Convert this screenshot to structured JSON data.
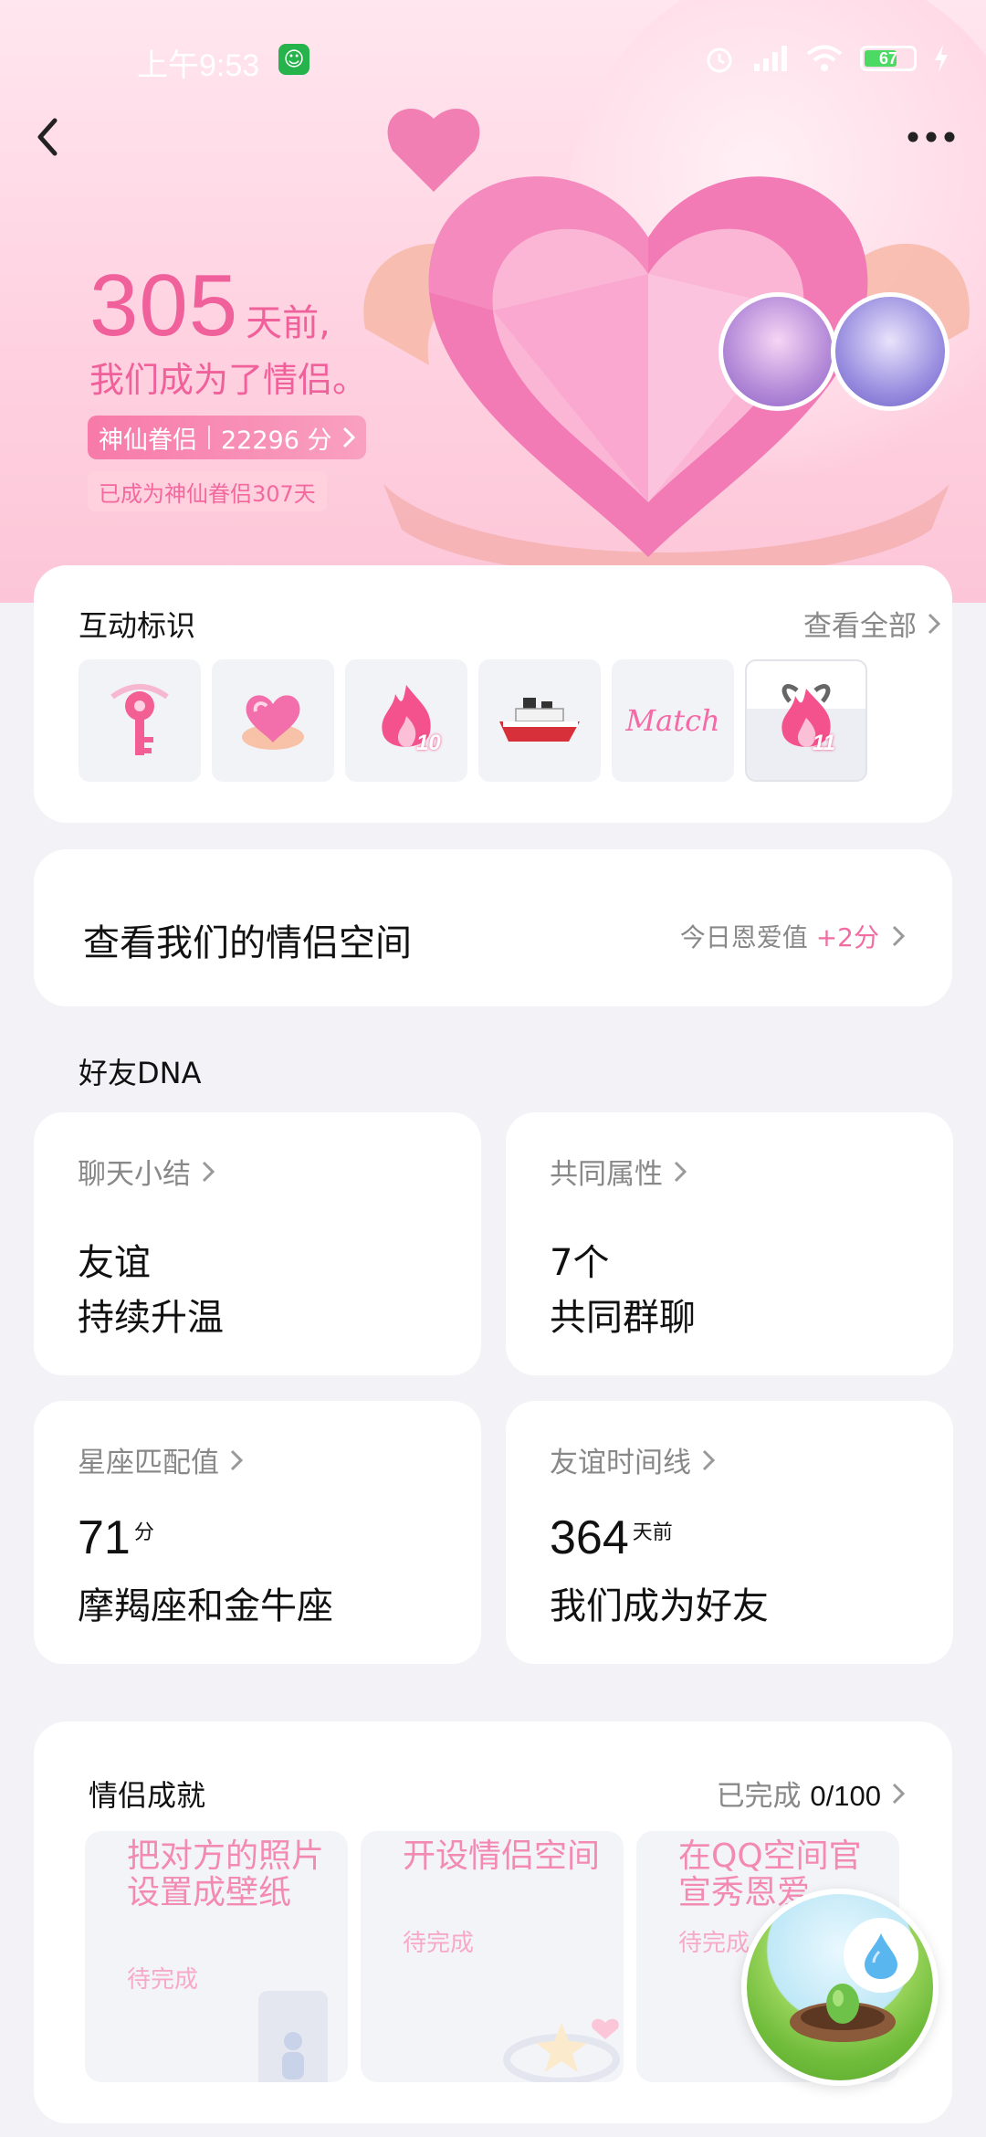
{
  "status_bar": {
    "time": "上午9:53",
    "battery": "67",
    "app_badge_icon": "cat-face-icon"
  },
  "hero": {
    "days_count": "305",
    "days_unit": "天前,",
    "subtitle": "我们成为了情侣。",
    "level_name": "神仙眷侣",
    "level_score": "22296 分",
    "since_text": "已成为神仙眷侣307天",
    "colors": {
      "accent": "#f0609a",
      "pill": "#f77aa8"
    }
  },
  "interaction_badges": {
    "title": "互动标识",
    "view_all": "查看全部",
    "badge_10": "10",
    "badge_11": "11",
    "match_text": "Match",
    "items": [
      "key-badge-icon",
      "heart-badge-icon",
      "fire-badge-icon",
      "ship-badge-icon",
      "match-badge-icon",
      "fire-badge-icon"
    ]
  },
  "couple_space": {
    "title": "查看我们的情侣空间",
    "meta_label": "今日恩爱值",
    "meta_value": "+2分"
  },
  "friend_dna": {
    "label": "好友DNA",
    "chat_summary": {
      "head": "聊天小结",
      "line1": "友谊",
      "line2": "持续升温"
    },
    "common": {
      "head": "共同属性",
      "line1": "7个",
      "line2": "共同群聊"
    },
    "zodiac": {
      "head": "星座匹配值",
      "num": "71",
      "unit": "分",
      "line2": "摩羯座和金牛座"
    },
    "timeline": {
      "head": "友谊时间线",
      "num": "364",
      "unit": "天前",
      "line2": "我们成为好友"
    }
  },
  "achievements": {
    "title": "情侣成就",
    "meta_label": "已完成",
    "meta_value": "0/100",
    "tiles": [
      {
        "title": "把对方的照片设置成壁纸",
        "status": "待完成"
      },
      {
        "title": "开设情侣空间",
        "status": "待完成"
      },
      {
        "title": "在QQ空间官宣秀恩爱",
        "status": "待完成"
      }
    ]
  }
}
